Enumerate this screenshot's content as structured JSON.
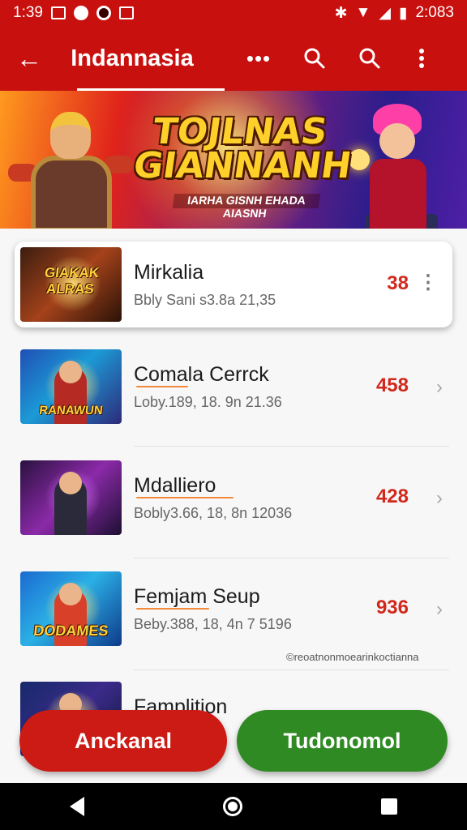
{
  "status_bar": {
    "time": "1:39",
    "battery": "2:083"
  },
  "app_bar": {
    "title": "Indannasia",
    "more_label": "•••",
    "search_label": "⚲",
    "overflow_label": "⋮",
    "back_label": "←"
  },
  "banner": {
    "title_line1": "TOJLNAS",
    "title_line2": "GIANNANH",
    "subtitle": "IARHA GISNH EHADA AIASNH"
  },
  "games": [
    {
      "thumb_label": "GIAKAK ALRAS",
      "name": "Mirkalia",
      "meta": "Bbly Sani s3.8a 21,35",
      "score": "38",
      "trailing": "⋮"
    },
    {
      "thumb_label": "RANAWUN",
      "name": "Comala Cerrck",
      "meta": "Loby.189, 18. 9n 21.36",
      "score": "458",
      "trailing": "›"
    },
    {
      "thumb_label": "",
      "name": "Mdalliero",
      "meta": "Bobly3.66, 18, 8n 12036",
      "score": "428",
      "trailing": "›"
    },
    {
      "thumb_label": "DODAMES",
      "name": "Femjam Seup",
      "meta": "Beby.388, 18, 4n 7 5196",
      "score": "936",
      "trailing": "›"
    },
    {
      "thumb_label": "",
      "name": "Famplition",
      "meta": "",
      "score": "",
      "trailing": ""
    }
  ],
  "watermark": "©reoatnonmoearinkoctianna",
  "actions": {
    "left": "Anckanal",
    "right": "Tudonomol"
  },
  "colors": {
    "primary_red": "#c8100e",
    "action_green": "#2f8a24",
    "score_red": "#d2281c"
  }
}
